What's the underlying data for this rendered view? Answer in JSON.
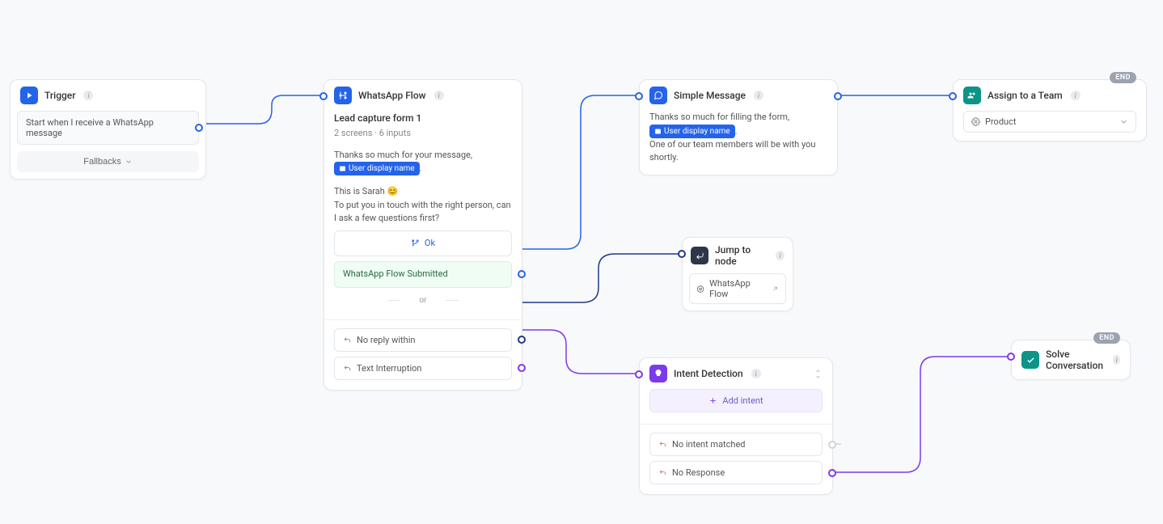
{
  "nodes": {
    "trigger": {
      "title": "Trigger",
      "start_text": "Start when I receive a WhatsApp message",
      "fallbacks_label": "Fallbacks"
    },
    "whatsapp_flow": {
      "title": "WhatsApp Flow",
      "form_title": "Lead capture form 1",
      "meta": "2 screens  ·  6 inputs",
      "msg_line1": "Thanks so much for your message,",
      "token": "User display name",
      "msg_line2": ".",
      "msg_line3": "This is Sarah 😊",
      "msg_line4": "To put you in touch with the right person, can I ask a few questions first?",
      "ok_label": "Ok",
      "submitted_label": "WhatsApp Flow Submitted",
      "or_label": "or",
      "no_reply": "No reply within",
      "text_interruption": "Text Interruption"
    },
    "simple_message": {
      "title": "Simple Message",
      "line1": "Thanks so much for filling the form,",
      "token": "User display name",
      "line2": ".",
      "line3": "One of our team members will be with you shortly."
    },
    "jump": {
      "title": "Jump to node",
      "target": "WhatsApp Flow"
    },
    "intent": {
      "title": "Intent Detection",
      "add_intent": "Add intent",
      "no_intent": "No intent matched",
      "no_response": "No Response"
    },
    "assign": {
      "title": "Assign to a Team",
      "team": "Product"
    },
    "solve": {
      "title": "Solve Conversation"
    }
  },
  "badges": {
    "end": "END"
  }
}
